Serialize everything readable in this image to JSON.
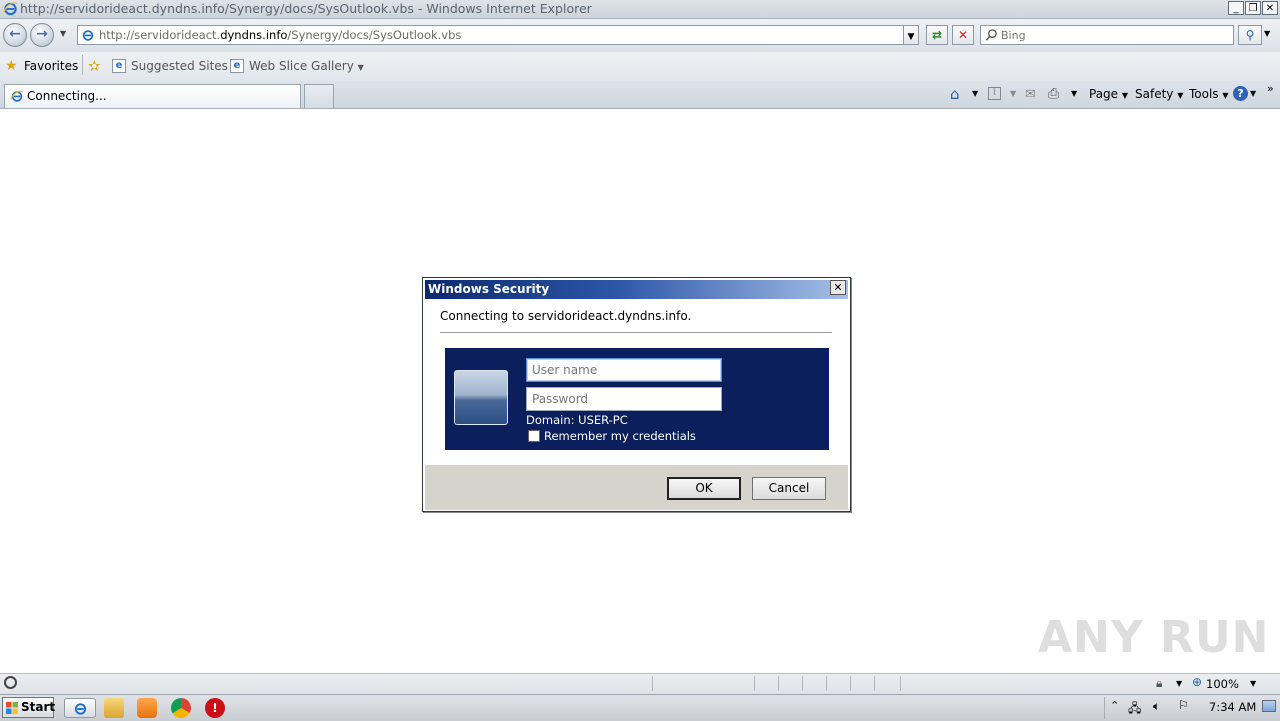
{
  "window": {
    "title": "http://servidorideact.dyndns.info/Synergy/docs/SysOutlook.vbs - Windows Internet Explorer"
  },
  "nav": {
    "address_prefix": "http://servidorideact.",
    "address_domain": "dyndns.info",
    "address_suffix": "/Synergy/docs/SysOutlook.vbs",
    "search_placeholder": "Bing"
  },
  "favorites": {
    "favorites_label": "Favorites",
    "suggested_sites": "Suggested Sites",
    "web_slice_gallery": "Web Slice Gallery"
  },
  "tabs": [
    {
      "label": "Connecting..."
    }
  ],
  "command_bar": {
    "page": "Page",
    "safety": "Safety",
    "tools": "Tools"
  },
  "dialog": {
    "title": "Windows Security",
    "message": "Connecting to servidorideact.dyndns.info.",
    "username_placeholder": "User name",
    "password_placeholder": "Password",
    "domain": "Domain: USER-PC",
    "remember": "Remember my credentials",
    "ok": "OK",
    "cancel": "Cancel"
  },
  "status_bar": {
    "zoom": "100%"
  },
  "taskbar": {
    "start": "Start",
    "clock": "7:34 AM"
  },
  "watermark": "ANY RUN",
  "colors": {
    "dialog_title_start": "#0a2a6e",
    "credential_panel": "#0a1f5c",
    "footer": "#d6d3cc"
  }
}
